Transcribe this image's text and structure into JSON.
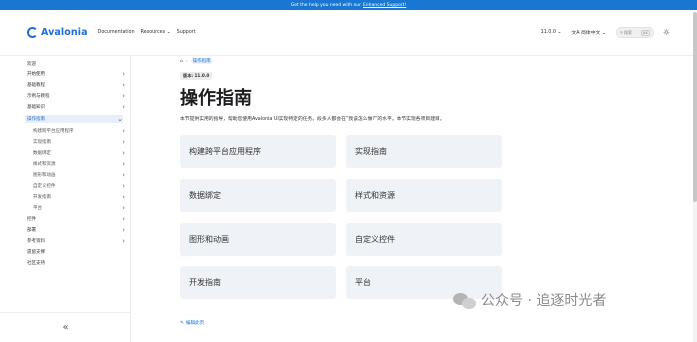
{
  "banner": {
    "text": "Get the help you need with our",
    "link": "Enhanced Support!"
  },
  "navbar": {
    "brand": "Avalonia",
    "links": [
      "Documentation",
      "Resources ⌄",
      "Support"
    ],
    "version": "11.0.0 ⌄",
    "language": "简体中文 ⌄",
    "search_placeholder": "搜索",
    "search_key": "⌘K"
  },
  "sidebar": {
    "items": [
      {
        "label": "欢迎",
        "chevron": ""
      },
      {
        "label": "开始使用",
        "chevron": "›"
      },
      {
        "label": "基础教程",
        "chevron": "›"
      },
      {
        "label": "示例与教程",
        "chevron": "›"
      },
      {
        "label": "基础知识",
        "chevron": "›"
      },
      {
        "label": "操作指南",
        "chevron": "⌄"
      },
      {
        "label": "构建跨平台应用程序",
        "chevron": "›"
      },
      {
        "label": "实现指南",
        "chevron": "›"
      },
      {
        "label": "数据绑定",
        "chevron": "›"
      },
      {
        "label": "样式和资源",
        "chevron": "›"
      },
      {
        "label": "图形和动画",
        "chevron": "›"
      },
      {
        "label": "自定义控件",
        "chevron": "›"
      },
      {
        "label": "开发指南",
        "chevron": "›"
      },
      {
        "label": "平台",
        "chevron": "›"
      },
      {
        "label": "控件",
        "chevron": "›"
      },
      {
        "label": "部署",
        "chevron": "›"
      },
      {
        "label": "参考资料",
        "chevron": "›"
      },
      {
        "label": "遗留支撑",
        "chevron": ""
      },
      {
        "label": "社区支持",
        "chevron": ""
      }
    ],
    "collapse": "«"
  },
  "breadcrumb": {
    "home": "⌂",
    "sep": "›",
    "current": "操作指南"
  },
  "version_badge": "版本: 11.0.0",
  "page_title": "操作指南",
  "intro": "本节提供实用的指导，帮助您使用Avalonia UI实现特定的任务。段多人都会在“我该怎么做?”的水平。本节实现各项目建目。",
  "cards": [
    "构建跨平台应用程序",
    "实现指南",
    "数据绑定",
    "样式和资源",
    "图形和动画",
    "自定义控件",
    "开发指南",
    "平台"
  ],
  "edit_link": "编辑此页",
  "watermark": "公众号 · 追逐时光者"
}
